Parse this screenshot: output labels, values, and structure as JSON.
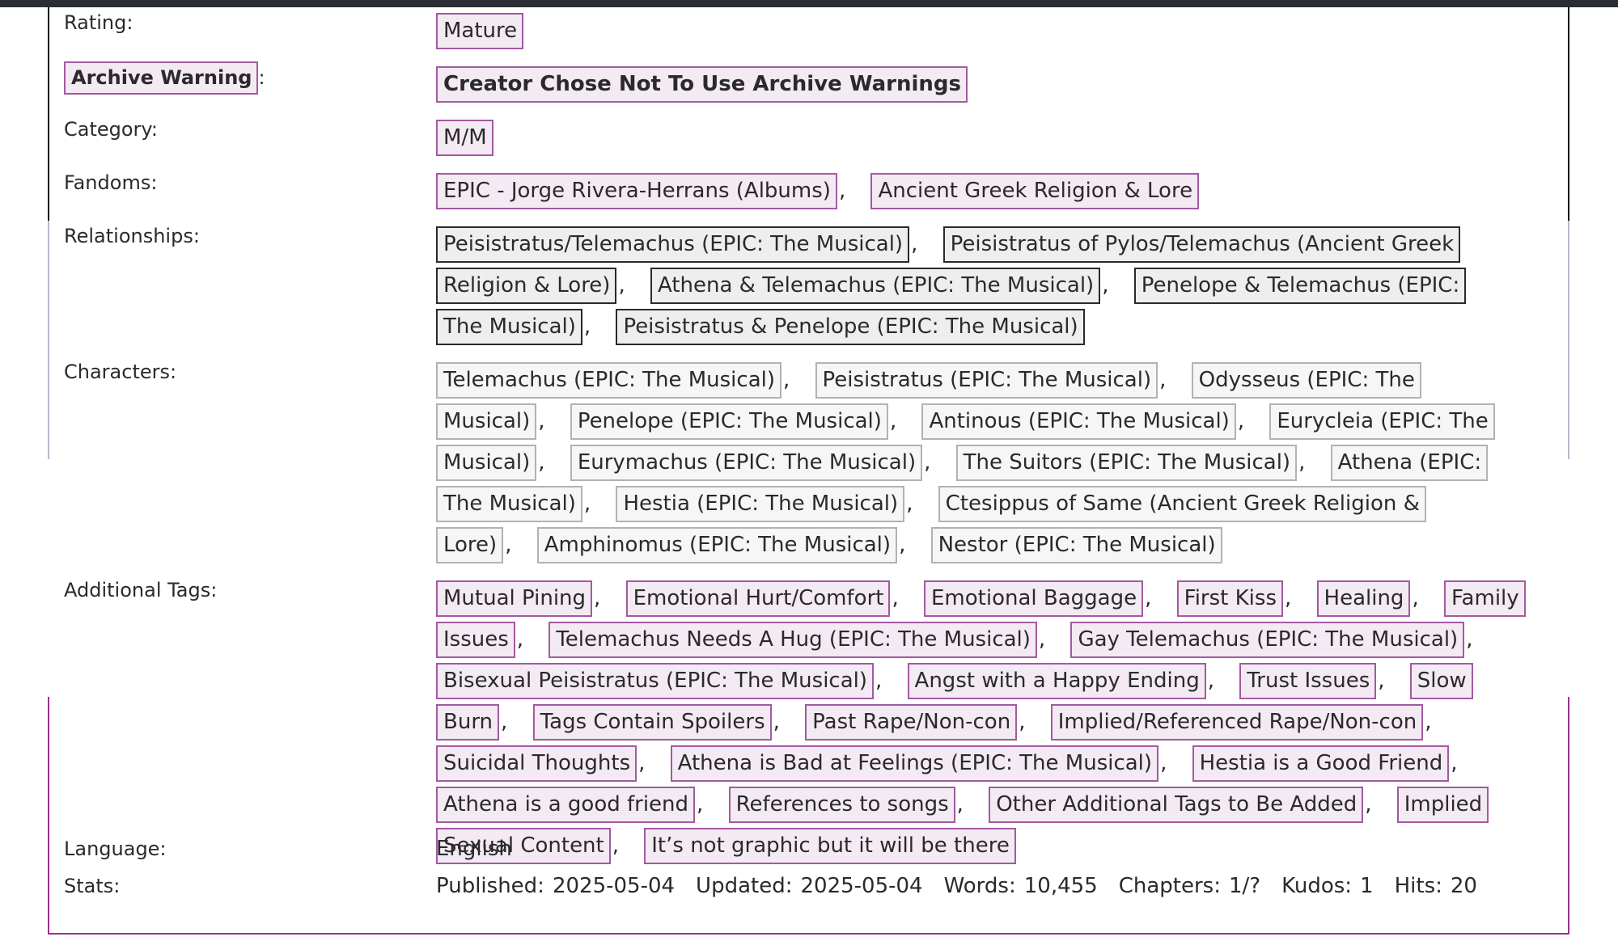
{
  "meta": {
    "rating": {
      "label": "Rating:",
      "tags": [
        "Mature"
      ]
    },
    "warning": {
      "label": "Archive Warning",
      "colon": ":",
      "tags": [
        "Creator Chose Not To Use Archive Warnings"
      ]
    },
    "category": {
      "label": "Category:",
      "tags": [
        "M/M"
      ]
    },
    "fandoms": {
      "label": "Fandoms:",
      "tags": [
        "EPIC - Jorge Rivera-Herrans (Albums)",
        "Ancient Greek Religion & Lore"
      ]
    },
    "relationships": {
      "label": "Relationships:",
      "tags": [
        "Peisistratus/Telemachus (EPIC: The Musical)",
        "Peisistratus of Pylos/Telemachus (Ancient Greek Religion & Lore)",
        "Athena & Telemachus (EPIC: The Musical)",
        "Penelope & Telemachus (EPIC: The Musical)",
        "Peisistratus & Penelope (EPIC: The Musical)"
      ]
    },
    "characters": {
      "label": "Characters:",
      "tags": [
        "Telemachus (EPIC: The Musical)",
        "Peisistratus (EPIC: The Musical)",
        "Odysseus (EPIC: The Musical)",
        "Penelope (EPIC: The Musical)",
        "Antinous (EPIC: The Musical)",
        "Eurycleia (EPIC: The Musical)",
        "Eurymachus (EPIC: The Musical)",
        "The Suitors (EPIC: The Musical)",
        "Athena (EPIC: The Musical)",
        "Hestia (EPIC: The Musical)",
        "Ctesippus of Same (Ancient Greek Religion & Lore)",
        "Amphinomus (EPIC: The Musical)",
        "Nestor (EPIC: The Musical)"
      ]
    },
    "additional": {
      "label": "Additional Tags:",
      "tags": [
        "Mutual Pining",
        "Emotional Hurt/Comfort",
        "Emotional Baggage",
        "First Kiss",
        "Healing",
        "Family Issues",
        "Telemachus Needs A Hug (EPIC: The Musical)",
        "Gay Telemachus (EPIC: The Musical)",
        "Bisexual Peisistratus (EPIC: The Musical)",
        "Angst with a Happy Ending",
        "Trust Issues",
        "Slow Burn",
        "Tags Contain Spoilers",
        "Past Rape/Non-con",
        "Implied/Referenced Rape/Non-con",
        "Suicidal Thoughts",
        "Athena is Bad at Feelings (EPIC: The Musical)",
        "Hestia is a Good Friend",
        "Athena is a good friend",
        "References to songs",
        "Other Additional Tags to Be Added",
        "Implied Sexual Content",
        "It’s not graphic but it will be there"
      ]
    },
    "language": {
      "label": "Language:",
      "value": "English"
    },
    "stats": {
      "label": "Stats:",
      "items": [
        {
          "key": "Published:",
          "value": "2025-05-04"
        },
        {
          "key": "Updated:",
          "value": "2025-05-04"
        },
        {
          "key": "Words:",
          "value": "10,455"
        },
        {
          "key": "Chapters:",
          "value": "1/?"
        },
        {
          "key": "Kudos:",
          "value": "1"
        },
        {
          "key": "Hits:",
          "value": "20"
        }
      ]
    }
  },
  "colors": {
    "accent": "#9b2f96",
    "tag_border": "#a25aa0",
    "tag_bg": "#f3eaf3",
    "relationship_border": "#2a2a2a",
    "character_border": "#b2b2b2",
    "topbar": "#2a2d34"
  }
}
